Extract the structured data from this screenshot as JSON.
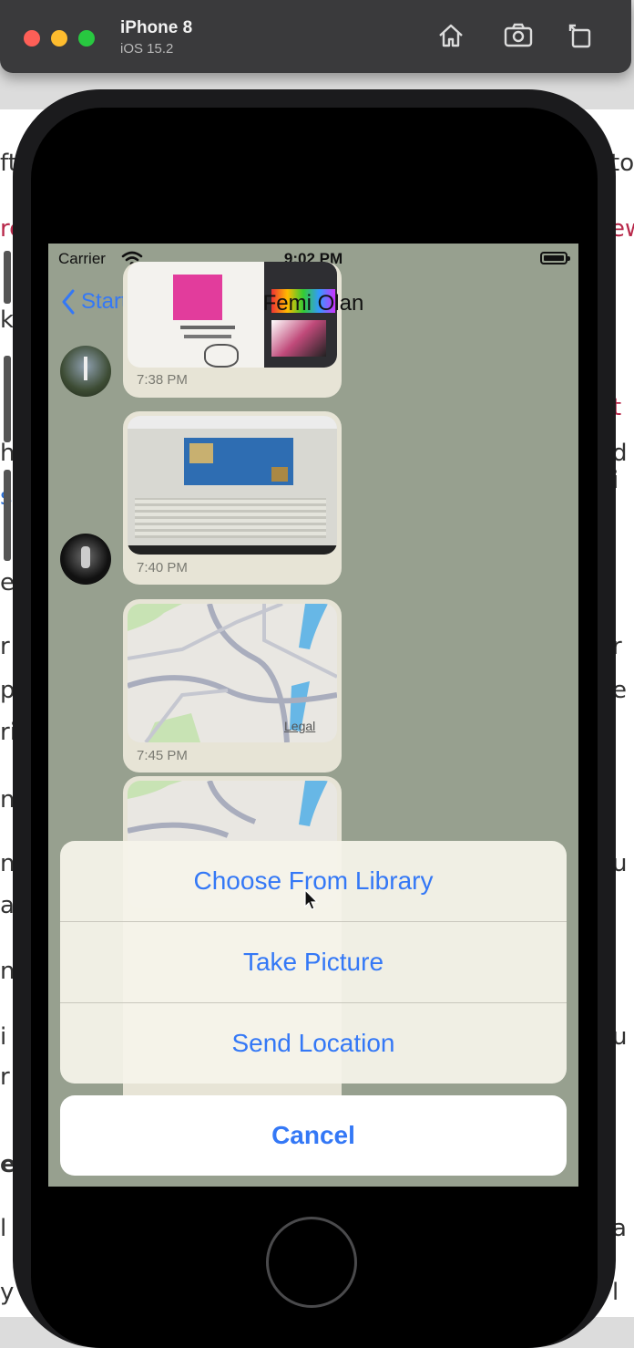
{
  "simulator": {
    "device": "iPhone 8",
    "os": "iOS 15.2",
    "traffic_colors": {
      "close": "#fe5f57",
      "minimize": "#febc2e",
      "zoom": "#28c840"
    },
    "icons": [
      "home-icon",
      "screenshot-icon",
      "rotate-icon"
    ]
  },
  "status_bar": {
    "carrier": "Carrier",
    "time": "9:02 PM"
  },
  "nav": {
    "back_label": "Start",
    "title": "Femi Olan"
  },
  "messages": [
    {
      "type": "image",
      "time": "7:38 PM"
    },
    {
      "type": "image",
      "time": "7:40 PM"
    },
    {
      "type": "map",
      "time": "7:45 PM",
      "map_label": "Legal"
    },
    {
      "type": "map"
    }
  ],
  "action_sheet": {
    "options": [
      "Choose From Library",
      "Take Picture",
      "Send Location"
    ],
    "cancel": "Cancel"
  },
  "colors": {
    "accent": "#3478f6",
    "chat_background": "#97a08f",
    "bubble": "#e7e4d6"
  }
}
